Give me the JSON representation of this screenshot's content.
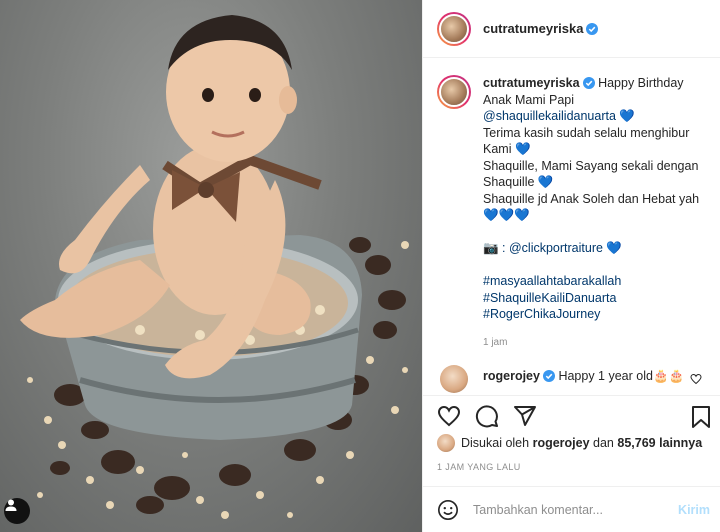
{
  "post": {
    "username": "cutratumeyriska",
    "verified": true
  },
  "caption": {
    "username": "cutratumeyriska",
    "lines": [
      "Happy Birthday",
      "Anak Mami Papi",
      "@shaquillekailidanuarta 💙",
      "Terima kasih sudah selalu menghibur",
      "Kami 💙",
      "Shaquille, Mami Sayang sekali dengan",
      "Shaquille 💙",
      "Shaquille jd Anak Soleh dan Hebat yah",
      "💙💙💙",
      "",
      "📷 : @clickportraiture 💙",
      "",
      "#masyaallahtabarakallah",
      "#ShaquilleKailiDanuarta",
      "#RogerChikaJourney"
    ],
    "time": "1 jam"
  },
  "comment": {
    "username": "rogerojey",
    "text": "Happy 1 year old🎂🎂"
  },
  "likes": {
    "prefix": "Disukai oleh",
    "username": "rogerojey",
    "middle": "dan",
    "count": "85,769",
    "suffix": "lainnya"
  },
  "timestamp": "1 JAM YANG LALU",
  "add_comment": {
    "placeholder": "Tambahkan komentar...",
    "post_label": "Kirim"
  },
  "icons": {
    "like": "heart-icon",
    "comment": "comment-icon",
    "share": "share-icon",
    "save": "bookmark-icon",
    "emoji": "emoji-icon",
    "user_tag": "user-icon",
    "verified": "verified-badge-icon"
  },
  "colors": {
    "link": "#00376b",
    "verified": "#3897f0",
    "muted": "#8e8e8e",
    "post_disabled": "#b2dffc"
  }
}
